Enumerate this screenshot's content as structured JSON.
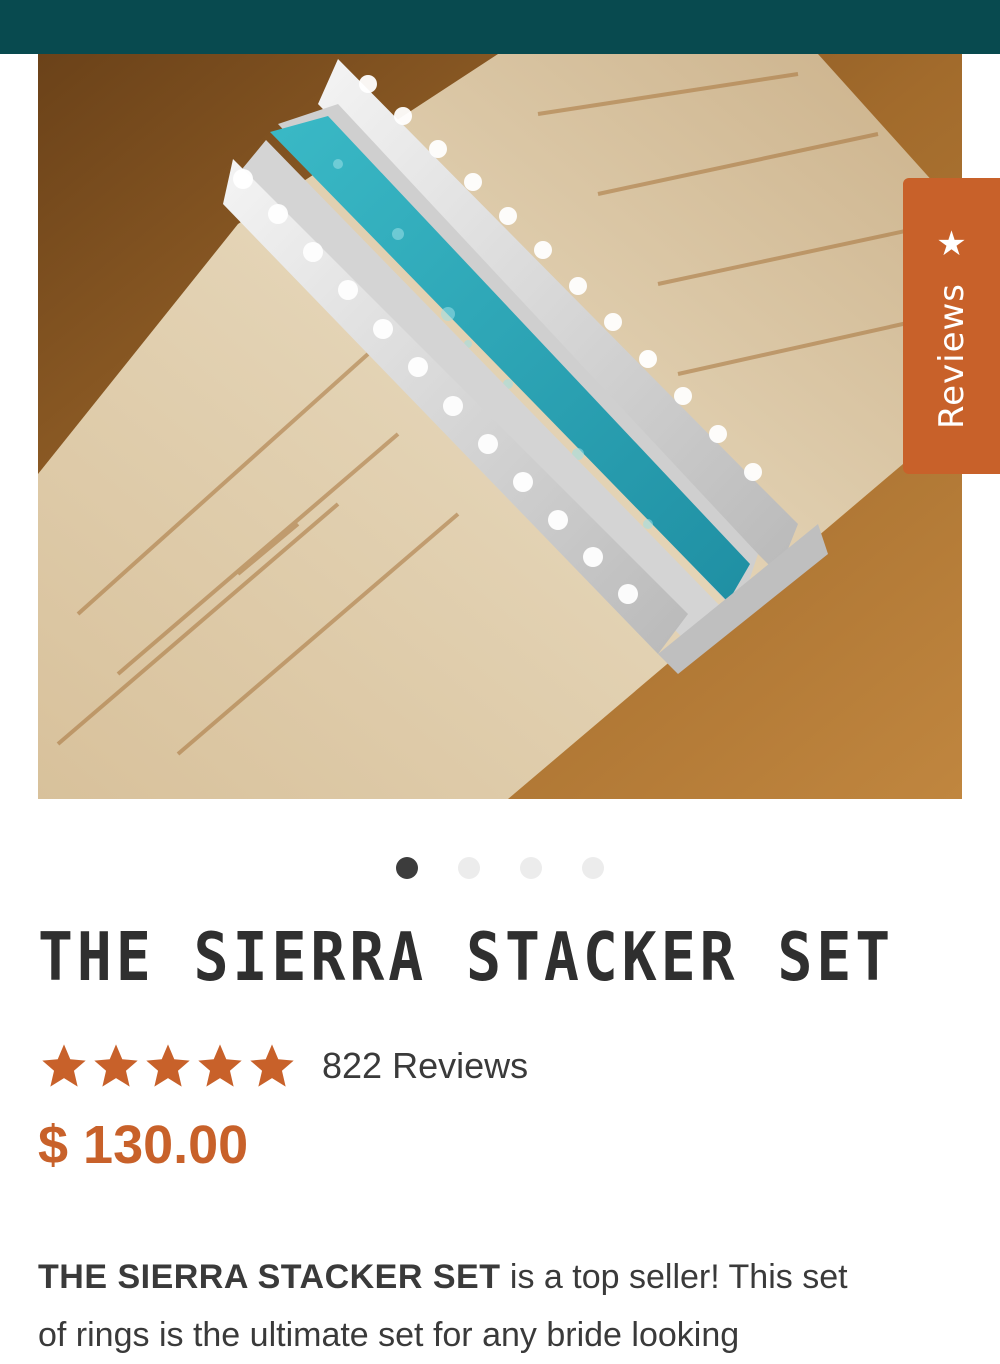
{
  "header": {
    "bar_color": "#084a4f"
  },
  "product": {
    "image": {
      "description_icon": "ring-stack-photo",
      "colors": {
        "background": "#8a5a26",
        "antler": "#d9c7a8",
        "turquoise": "#2aa3b4",
        "silver": "#e6e6e6"
      }
    },
    "carousel": {
      "total": 4,
      "active_index": 1
    },
    "title": "THE SIERRA STACKER SET",
    "rating": {
      "stars": 5,
      "star_icon": "star-icon",
      "star_color": "#c8612a",
      "review_count_label": "822 Reviews"
    },
    "price": "$ 130.00",
    "description": {
      "lead": "THE SIERRA STACKER SET",
      "line1_rest": " is a top seller! This set",
      "line2": "of rings is the ultimate set for any bride looking"
    }
  },
  "reviews_tab": {
    "icon": "star-icon",
    "label": "Reviews",
    "color": "#c8612a"
  }
}
